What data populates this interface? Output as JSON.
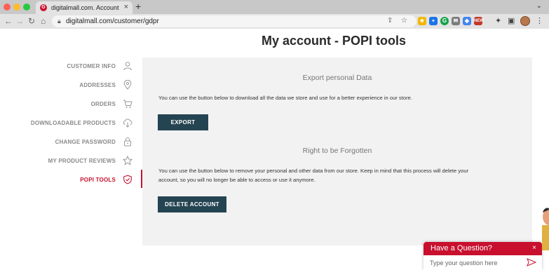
{
  "browser": {
    "tab_title": "digitalmall.com. Account",
    "favicon_letter": "G",
    "url": "digitalmall.com/customer/gdpr",
    "icons": [
      "back-arrow-icon",
      "forward-arrow-icon",
      "reload-icon",
      "home-icon",
      "lock-icon",
      "share-icon",
      "bookmark-star-icon",
      "extensions-icon",
      "sidebar-icon"
    ]
  },
  "page": {
    "title": "My account - POPI tools"
  },
  "sidebar": {
    "active_color": "#c8102e",
    "items": [
      {
        "label": "CUSTOMER INFO",
        "icon": "person-icon",
        "active": false
      },
      {
        "label": "ADDRESSES",
        "icon": "map-pin-icon",
        "active": false
      },
      {
        "label": "ORDERS",
        "icon": "cart-icon",
        "active": false
      },
      {
        "label": "DOWNLOADABLE PRODUCTS",
        "icon": "cloud-download-icon",
        "active": false
      },
      {
        "label": "CHANGE PASSWORD",
        "icon": "padlock-icon",
        "active": false
      },
      {
        "label": "MY PRODUCT REVIEWS",
        "icon": "star-icon",
        "active": false
      },
      {
        "label": "POPI TOOLS",
        "icon": "shield-check-icon",
        "active": true
      }
    ]
  },
  "export": {
    "title": "Export personal Data",
    "description": "You can use the button below to download all the data we store and use for a better experience in our store.",
    "button_label": "EXPORT"
  },
  "forget": {
    "title": "Right to be Forgotten",
    "description_line1": "You can use the button below to remove your personal and other data from our store. Keep in mind that this process will delete your",
    "description_line2": "account, so you will no longer be able to access or use it anymore.",
    "button_label": "DELETE ACCOUNT"
  },
  "chat": {
    "title": "Have a Question?",
    "close": "×",
    "placeholder": "Type your question here",
    "accent": "#c8102e"
  },
  "colors": {
    "button_bg": "#254452",
    "panel_bg": "#f2f2f2"
  }
}
